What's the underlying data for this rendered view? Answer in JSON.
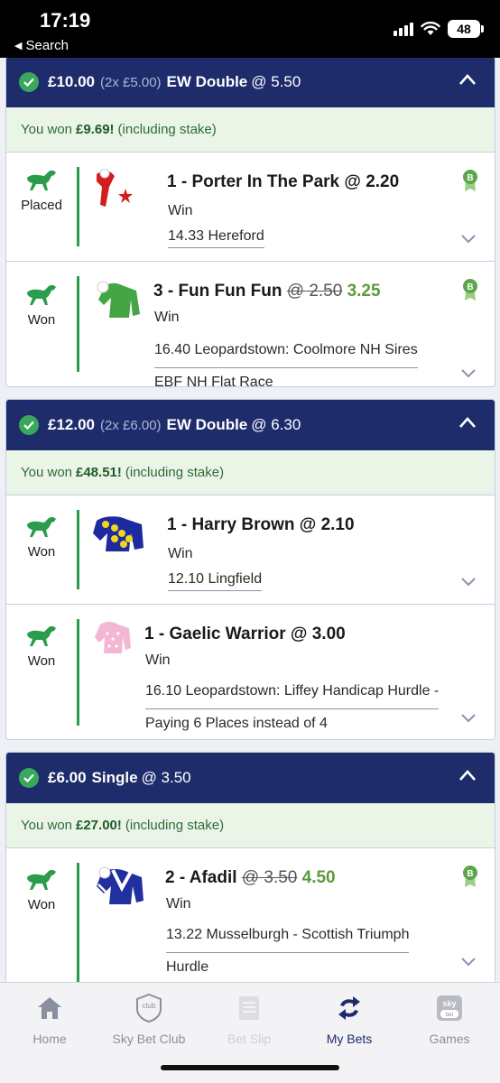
{
  "status_bar": {
    "time": "17:19",
    "back_label": "Search",
    "battery": "48"
  },
  "bets": [
    {
      "stake": "£10.00",
      "split": "(2x £5.00)",
      "type": "EW Double",
      "odds": "@ 5.50",
      "won_prefix": "You won",
      "won_amount": "£9.69!",
      "won_suffix": "(including stake)",
      "legs": [
        {
          "result": "Placed",
          "selection": "1 - Porter In The Park",
          "odds": "@ 2.20",
          "market": "Win",
          "race_line1": "14.33 Hereford",
          "race_line2": ""
        },
        {
          "result": "Won",
          "selection": "3 - Fun Fun Fun",
          "old_odds": "@ 2.50",
          "new_odds": "3.25",
          "market": "Win",
          "race_line1": "16.40 Leopardstown: Coolmore NH Sires",
          "race_line2": "EBF NH Flat Race"
        }
      ]
    },
    {
      "stake": "£12.00",
      "split": "(2x £6.00)",
      "type": "EW Double",
      "odds": "@ 6.30",
      "won_prefix": "You won",
      "won_amount": "£48.51!",
      "won_suffix": "(including stake)",
      "legs": [
        {
          "result": "Won",
          "selection": "1 - Harry Brown",
          "odds": "@ 2.10",
          "market": "Win",
          "race_line1": "12.10 Lingfield",
          "race_line2": ""
        },
        {
          "result": "Won",
          "selection": "1 - Gaelic Warrior",
          "odds": "@ 3.00",
          "market": "Win",
          "race_line1": "16.10 Leopardstown: Liffey Handicap Hurdle -",
          "race_line2": "Paying 6 Places instead of 4"
        }
      ]
    },
    {
      "stake": "£6.00",
      "split": "",
      "type": "Single",
      "odds": "@ 3.50",
      "won_prefix": "You won",
      "won_amount": "£27.00!",
      "won_suffix": "(including stake)",
      "legs": [
        {
          "result": "Won",
          "selection": "2 - Afadil",
          "old_odds": "@ 3.50",
          "new_odds": "4.50",
          "market": "Win",
          "race_line1": "13.22 Musselburgh - Scottish Triumph",
          "race_line2": "Hurdle"
        }
      ]
    }
  ],
  "nav": {
    "items": [
      {
        "label": "Home",
        "icon": "home-icon"
      },
      {
        "label": "Sky Bet Club",
        "icon": "club-shield-icon",
        "icon_text": "club"
      },
      {
        "label": "Bet Slip",
        "icon": "betslip-icon"
      },
      {
        "label": "My Bets",
        "icon": "refresh-arrows-icon"
      },
      {
        "label": "Games",
        "icon": "skybet-games-icon",
        "icon_text_top": "sky",
        "icon_text_bottom": "bet"
      }
    ],
    "active": "My Bets"
  },
  "colors": {
    "header_navy": "#1e2c6c",
    "won_green": "#2a9c4c",
    "won_bg": "#eaf5e8",
    "odds_green": "#5d9a3a"
  }
}
